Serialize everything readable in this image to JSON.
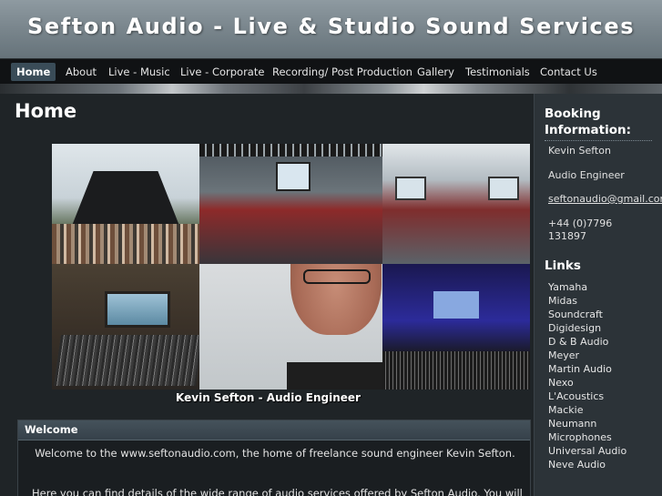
{
  "header": {
    "title": "Sefton Audio - Live & Studio Sound Services"
  },
  "nav": {
    "items": [
      {
        "label": "Home",
        "active": true
      },
      {
        "label": "About"
      },
      {
        "label": "Live - Music"
      },
      {
        "label": "Live - Corporate"
      },
      {
        "label": "Recording/ Post Production"
      },
      {
        "label": "Gallery"
      },
      {
        "label": "Testimonials"
      },
      {
        "label": "Contact Us"
      }
    ]
  },
  "main": {
    "page_title": "Home",
    "caption": "Kevin Sefton - Audio Engineer",
    "welcome": {
      "heading": "Welcome",
      "paragraph1": "Welcome to the www.seftonaudio.com, the home of freelance sound engineer Kevin Sefton.",
      "paragraph2": "Here you can find details of the wide range of audio services offered by Sefton Audio. You will"
    }
  },
  "sidebar": {
    "booking_heading": "Booking Information:",
    "name": "Kevin Sefton",
    "role": "Audio Engineer",
    "email": "seftonaudio@gmail.com",
    "phone_line1": "+44 (0)7796",
    "phone_line2": "131897",
    "links_heading": "Links",
    "links": [
      "Yamaha",
      "Midas",
      "Soundcraft",
      "Digidesign",
      "D & B Audio",
      "Meyer",
      "Martin Audio",
      "Nexo",
      "L'Acoustics",
      "Mackie",
      "Neumann Microphones",
      "Universal Audio",
      "Neve Audio"
    ]
  }
}
